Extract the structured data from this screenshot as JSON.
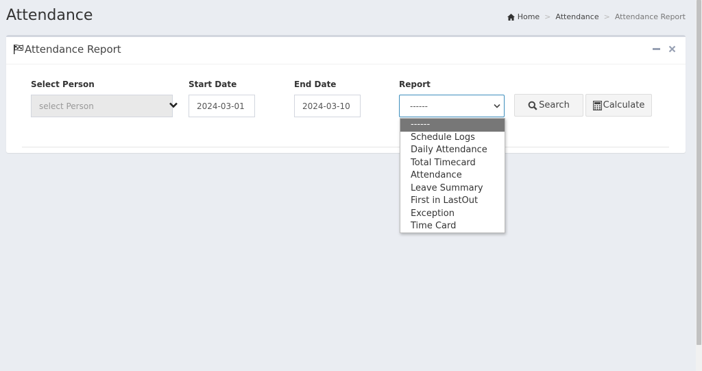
{
  "page": {
    "title": "Attendance"
  },
  "breadcrumb": {
    "home": "Home",
    "section": "Attendance",
    "current": "Attendance Report",
    "separator": ">"
  },
  "card": {
    "title": "Attendance Report",
    "minimize_icon": "minus-icon",
    "close_icon": "times-icon"
  },
  "form": {
    "person": {
      "label": "Select Person",
      "placeholder": "select Person"
    },
    "start_date": {
      "label": "Start Date",
      "value": "2024-03-01"
    },
    "end_date": {
      "label": "End Date",
      "value": "2024-03-10"
    },
    "report": {
      "label": "Report",
      "selected": "------"
    },
    "search_button": {
      "label": "Search",
      "icon": "search-icon"
    },
    "calculate_button": {
      "label": "Calculate",
      "icon": "calculator-icon"
    }
  },
  "report_options": [
    "------",
    "Schedule Logs",
    "Daily Attendance",
    "Total Timecard",
    "Attendance",
    "Leave Summary",
    "First in LastOut",
    "Exception",
    "Time Card"
  ],
  "colors": {
    "background": "#eaedf2",
    "select_focus": "#3c8dbc",
    "option_selected": "#777777"
  }
}
